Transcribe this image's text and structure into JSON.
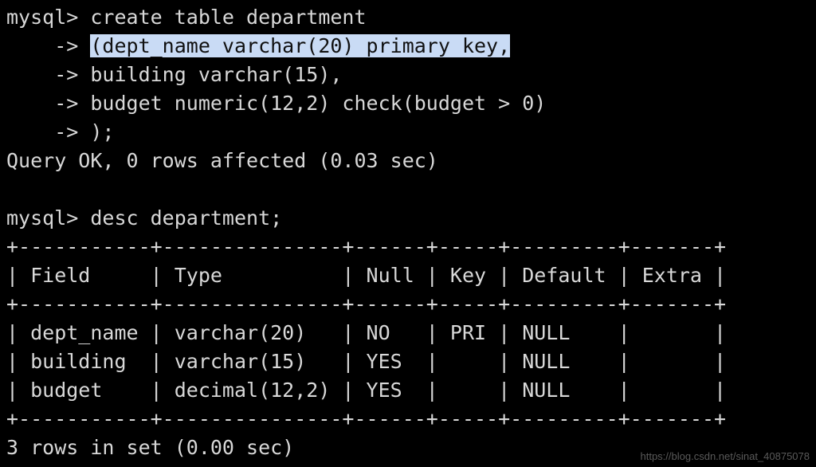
{
  "terminal": {
    "app": "mysql-client-terminal",
    "background_color": "#000000",
    "foreground_color": "#d8d8d8",
    "selection_background_color": "#c9dbf5",
    "selection_foreground_color": "#101010",
    "prompt": "mysql>",
    "continuation_prompt": "->",
    "lines": [
      {
        "id": "line-01",
        "kind": "prompt-command",
        "text": "mysql> create table department"
      },
      {
        "id": "line-02",
        "kind": "continuation-selected",
        "prefix": "    -> ",
        "selected": "(dept_name varchar(20) primary key,",
        "suffix": ""
      },
      {
        "id": "line-03",
        "kind": "continuation",
        "text": "    -> building varchar(15),"
      },
      {
        "id": "line-04",
        "kind": "continuation",
        "text": "    -> budget numeric(12,2) check(budget > 0)"
      },
      {
        "id": "line-05",
        "kind": "continuation",
        "text": "    -> );"
      },
      {
        "id": "line-06",
        "kind": "result",
        "text": "Query OK, 0 rows affected (0.03 sec)"
      },
      {
        "id": "line-07",
        "kind": "blank",
        "text": ""
      },
      {
        "id": "line-08",
        "kind": "prompt-command",
        "text": "mysql> desc department;"
      },
      {
        "id": "line-09",
        "kind": "table-rule",
        "text": "+-----------+---------------+------+-----+---------+-------+"
      },
      {
        "id": "line-10",
        "kind": "table-header",
        "text": "| Field     | Type          | Null | Key | Default | Extra |"
      },
      {
        "id": "line-11",
        "kind": "table-rule",
        "text": "+-----------+---------------+------+-----+---------+-------+"
      },
      {
        "id": "line-12",
        "kind": "table-row",
        "text": "| dept_name | varchar(20)   | NO   | PRI | NULL    |       |"
      },
      {
        "id": "line-13",
        "kind": "table-row",
        "text": "| building  | varchar(15)   | YES  |     | NULL    |       |"
      },
      {
        "id": "line-14",
        "kind": "table-row",
        "text": "| budget    | decimal(12,2) | YES  |     | NULL    |       |"
      },
      {
        "id": "line-15",
        "kind": "table-rule",
        "text": "+-----------+---------------+------+-----+---------+-------+"
      },
      {
        "id": "line-16",
        "kind": "result",
        "text": "3 rows in set (0.00 sec)"
      }
    ]
  },
  "result_table": {
    "columns": [
      "Field",
      "Type",
      "Null",
      "Key",
      "Default",
      "Extra"
    ],
    "rows": [
      [
        "dept_name",
        "varchar(20)",
        "NO",
        "PRI",
        "NULL",
        ""
      ],
      [
        "building",
        "varchar(15)",
        "YES",
        "",
        "NULL",
        ""
      ],
      [
        "budget",
        "decimal(12,2)",
        "YES",
        "",
        "NULL",
        ""
      ]
    ],
    "row_count_text": "3 rows in set (0.00 sec)"
  },
  "statements": {
    "create_table": "create table department (dept_name varchar(20) primary key, building varchar(15), budget numeric(12,2) check(budget > 0));",
    "describe": "desc department;",
    "create_result": "Query OK, 0 rows affected (0.03 sec)"
  },
  "watermark": {
    "text": "https://blog.csdn.net/sinat_40875078"
  }
}
